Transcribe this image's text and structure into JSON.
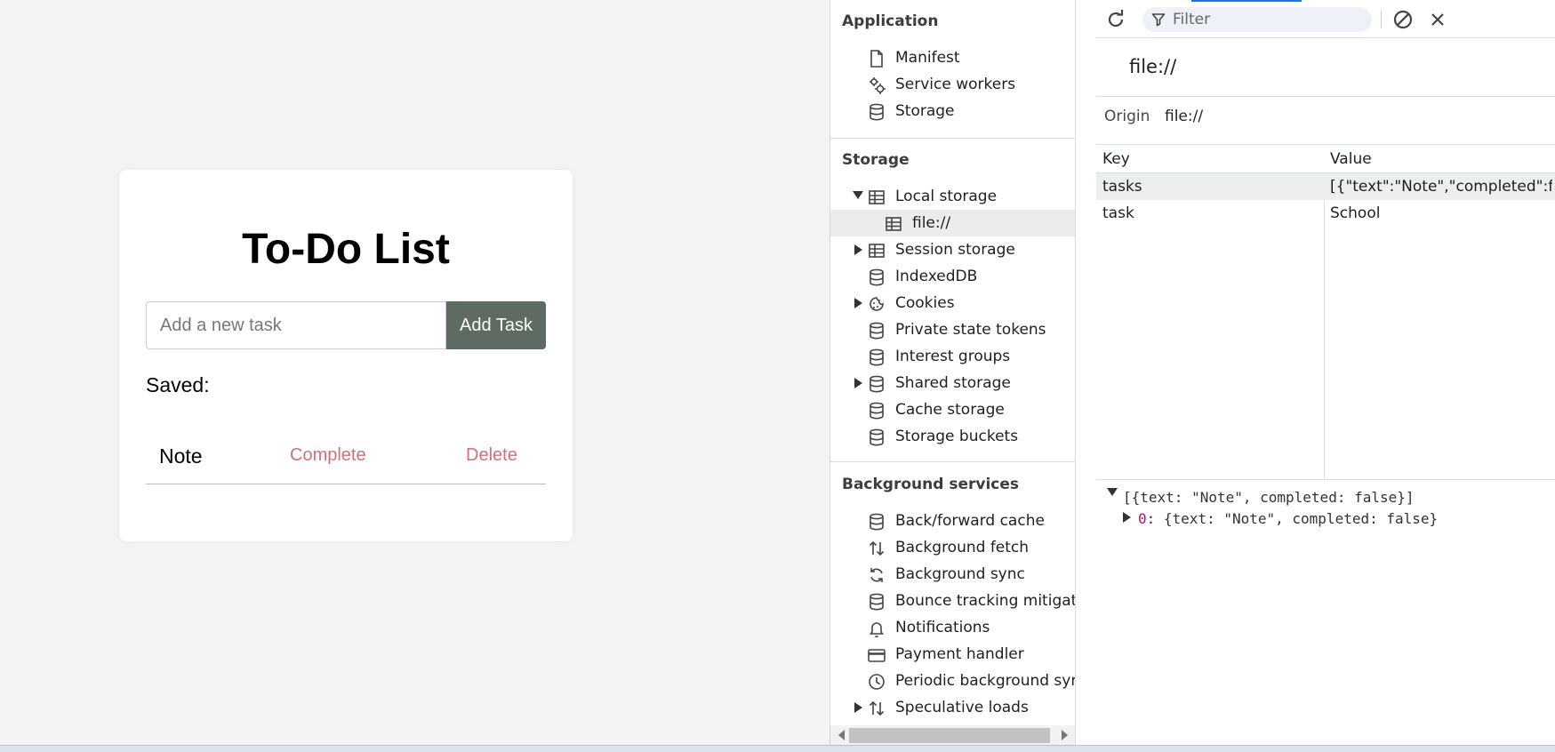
{
  "app": {
    "title": "To-Do List",
    "input_placeholder": "Add a new task",
    "add_button": "Add Task",
    "saved_label": "Saved:",
    "tasks": [
      {
        "text": "Note",
        "complete_label": "Complete",
        "delete_label": "Delete"
      }
    ]
  },
  "devtools": {
    "sidebar": {
      "sections": [
        {
          "title": "Application",
          "items": [
            {
              "label": "Manifest",
              "icon": "document-icon"
            },
            {
              "label": "Service workers",
              "icon": "gears-icon"
            },
            {
              "label": "Storage",
              "icon": "database-icon"
            }
          ]
        },
        {
          "title": "Storage",
          "items": [
            {
              "label": "Local storage",
              "icon": "table-icon",
              "expander": "expanded"
            },
            {
              "label": "file://",
              "icon": "table-icon",
              "selected": true,
              "child": true
            },
            {
              "label": "Session storage",
              "icon": "table-icon",
              "expander": "collapsed"
            },
            {
              "label": "IndexedDB",
              "icon": "database-icon"
            },
            {
              "label": "Cookies",
              "icon": "cookie-icon",
              "expander": "collapsed"
            },
            {
              "label": "Private state tokens",
              "icon": "database-icon"
            },
            {
              "label": "Interest groups",
              "icon": "database-icon"
            },
            {
              "label": "Shared storage",
              "icon": "database-icon",
              "expander": "collapsed"
            },
            {
              "label": "Cache storage",
              "icon": "database-icon"
            },
            {
              "label": "Storage buckets",
              "icon": "database-icon"
            }
          ]
        },
        {
          "title": "Background services",
          "items": [
            {
              "label": "Back/forward cache",
              "icon": "database-icon"
            },
            {
              "label": "Background fetch",
              "icon": "updown-arrows-icon"
            },
            {
              "label": "Background sync",
              "icon": "sync-icon"
            },
            {
              "label": "Bounce tracking mitigations",
              "icon": "database-icon"
            },
            {
              "label": "Notifications",
              "icon": "bell-icon"
            },
            {
              "label": "Payment handler",
              "icon": "card-icon"
            },
            {
              "label": "Periodic background sync",
              "icon": "clock-icon"
            },
            {
              "label": "Speculative loads",
              "icon": "updown-arrows-icon",
              "expander": "collapsed"
            }
          ]
        }
      ]
    },
    "toolbar": {
      "filter_placeholder": "Filter"
    },
    "origin_title": "file://",
    "origin_key": "Origin",
    "origin_value": "file://",
    "table": {
      "headers": [
        "Key",
        "Value"
      ],
      "rows": [
        {
          "key": "tasks",
          "value": "[{\"text\":\"Note\",\"completed\":f...",
          "selected": true
        },
        {
          "key": "task",
          "value": "School",
          "selected": false
        }
      ]
    },
    "preview": {
      "root": "[{text: \"Note\", completed: false}]",
      "child_index": "0",
      "child_value": ": {text: \"Note\", completed: false}"
    }
  }
}
